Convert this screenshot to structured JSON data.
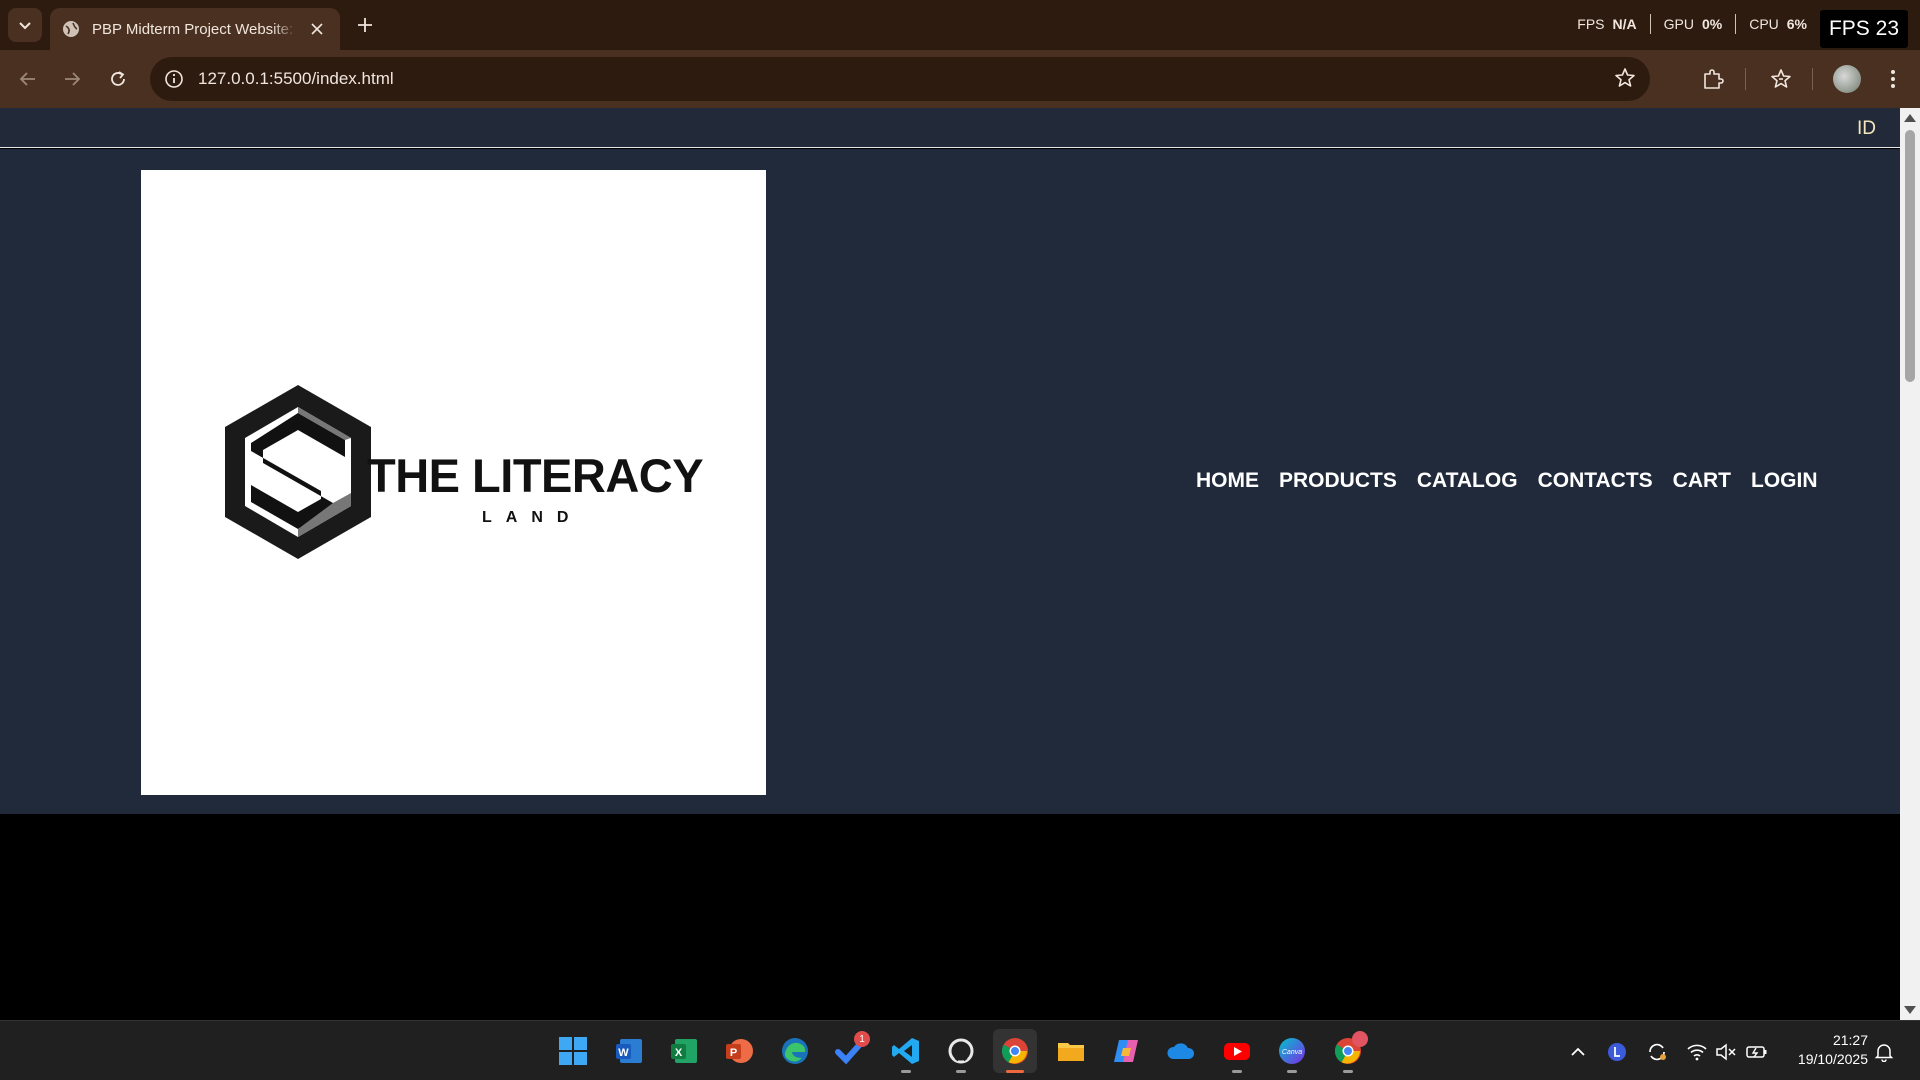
{
  "browser": {
    "tab": {
      "title": "PBP Midterm Project Website: The Literacy Land"
    },
    "address": {
      "url": "127.0.0.1:5500/index.html"
    },
    "perf": {
      "fps_label": "FPS",
      "fps_value": "N/A",
      "gpu_label": "GPU",
      "gpu_value": "0%",
      "cpu_label": "CPU",
      "cpu_value": "6%"
    },
    "fps_overlay": "FPS 23"
  },
  "page": {
    "topbar": {
      "lang": "ID"
    },
    "logo": {
      "title": "THE LITERACY",
      "subtitle": "LAND"
    },
    "nav": [
      {
        "label": "HOME"
      },
      {
        "label": "PRODUCTS"
      },
      {
        "label": "CATALOG"
      },
      {
        "label": "CONTACTS"
      },
      {
        "label": "CART"
      },
      {
        "label": "LOGIN"
      }
    ],
    "colors": {
      "header_bg": "#212a3b",
      "topbar_bg": "#222a3a",
      "lang_text": "#f4e7bc",
      "body_bg": "#000000"
    }
  },
  "taskbar": {
    "apps": [
      {
        "name": "windows-start"
      },
      {
        "name": "word"
      },
      {
        "name": "excel"
      },
      {
        "name": "powerpoint"
      },
      {
        "name": "edge-dev"
      },
      {
        "name": "todo",
        "badge": "1"
      },
      {
        "name": "vscode"
      },
      {
        "name": "github-desktop"
      },
      {
        "name": "chrome"
      },
      {
        "name": "file-explorer"
      },
      {
        "name": "copilot"
      },
      {
        "name": "onedrive"
      },
      {
        "name": "youtube"
      },
      {
        "name": "canva"
      },
      {
        "name": "chrome-profile"
      }
    ],
    "canva_label": "Canva",
    "clock": {
      "time": "21:27",
      "date": "19/10/2025"
    }
  }
}
